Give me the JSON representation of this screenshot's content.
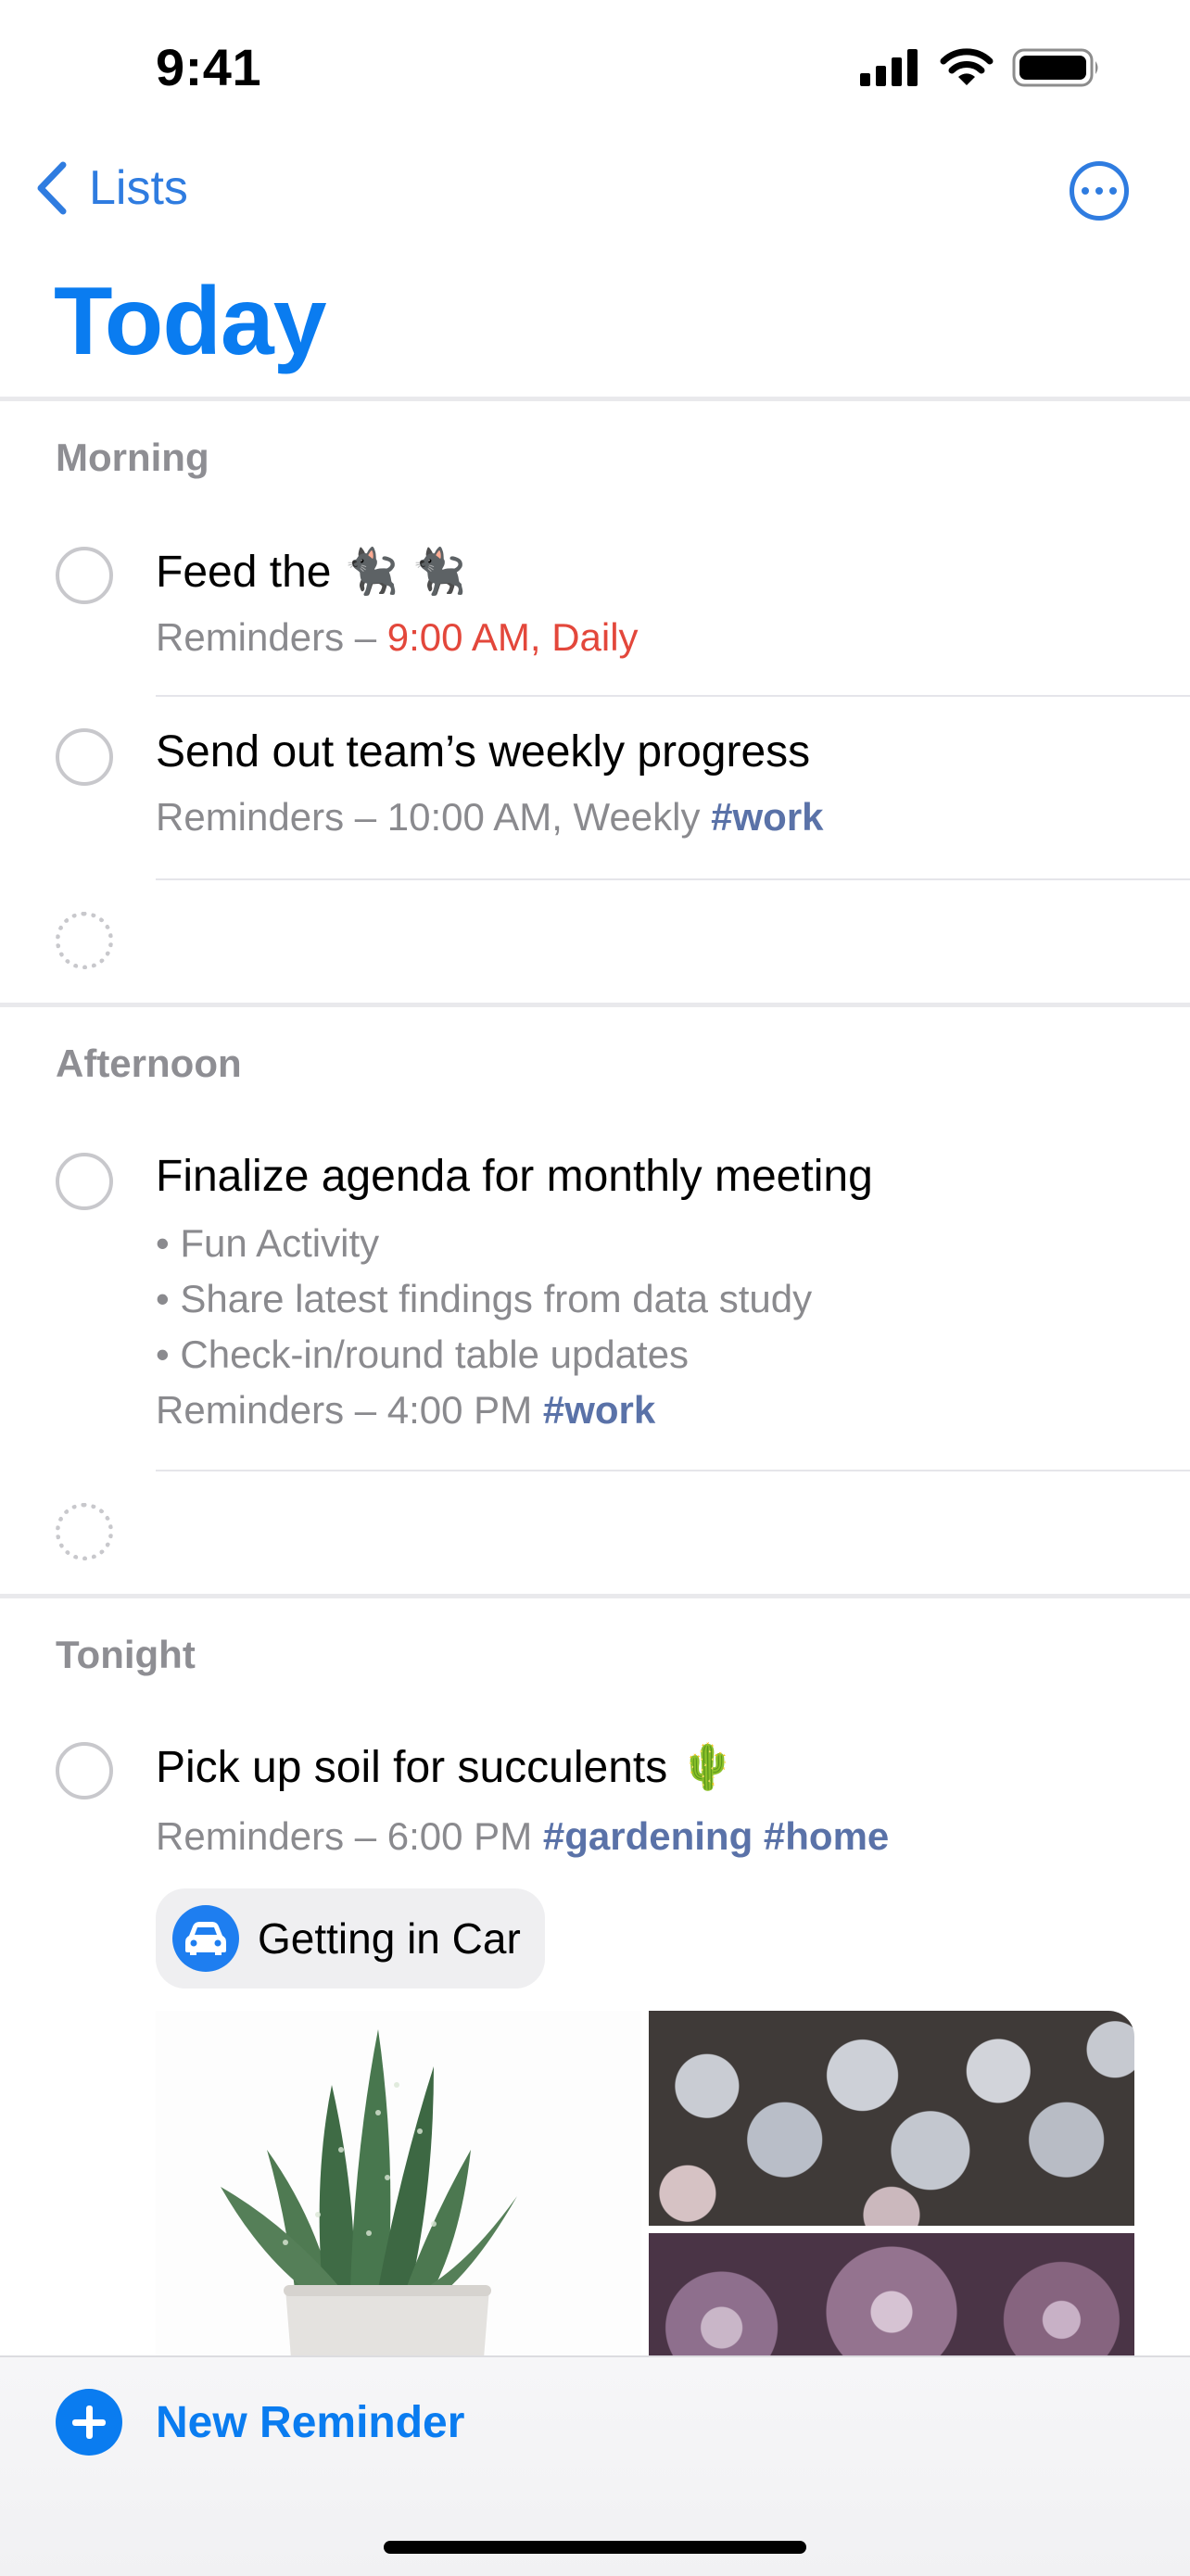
{
  "status_bar": {
    "time": "9:41",
    "icons": [
      "signal-icon",
      "wifi-icon",
      "battery-icon"
    ]
  },
  "nav": {
    "back_label": "Lists",
    "back_icon": "chevron-left-icon",
    "more_icon": "ellipsis-circle-icon"
  },
  "title": "Today",
  "colors": {
    "accent": "#0a7cf0",
    "due_red": "#e3473b",
    "tag": "#5a72a8",
    "secondary": "#8a8a8e"
  },
  "sections": {
    "morning": {
      "header": "Morning",
      "items": [
        {
          "title": "Feed the 🐈‍⬛ 🐈‍⬛",
          "list": "Reminders – ",
          "due": "9:00 AM, Daily"
        },
        {
          "title": "Send out team’s weekly progress",
          "list": "Reminders – 10:00 AM, Weekly ",
          "tag": "#work"
        }
      ]
    },
    "afternoon": {
      "header": "Afternoon",
      "items": [
        {
          "title": "Finalize agenda for monthly meeting",
          "notes": [
            "• Fun Activity",
            "• Share latest findings from data study",
            "• Check-in/round table updates"
          ],
          "list": "Reminders – 4:00 PM ",
          "tag": "#work"
        }
      ]
    },
    "tonight": {
      "header": "Tonight",
      "items": [
        {
          "title": "Pick up soil for succulents 🌵",
          "list": "Reminders – 6:00 PM ",
          "tags": [
            "#gardening",
            "#home"
          ],
          "location": {
            "icon": "car-icon",
            "label": "Getting in Car"
          },
          "images": [
            "aloe-plant-photo",
            "lithops-photo",
            "succulent-rosettes-photo"
          ]
        }
      ]
    }
  },
  "bottom": {
    "new_label": "New Reminder",
    "new_icon": "plus-circle-icon"
  }
}
